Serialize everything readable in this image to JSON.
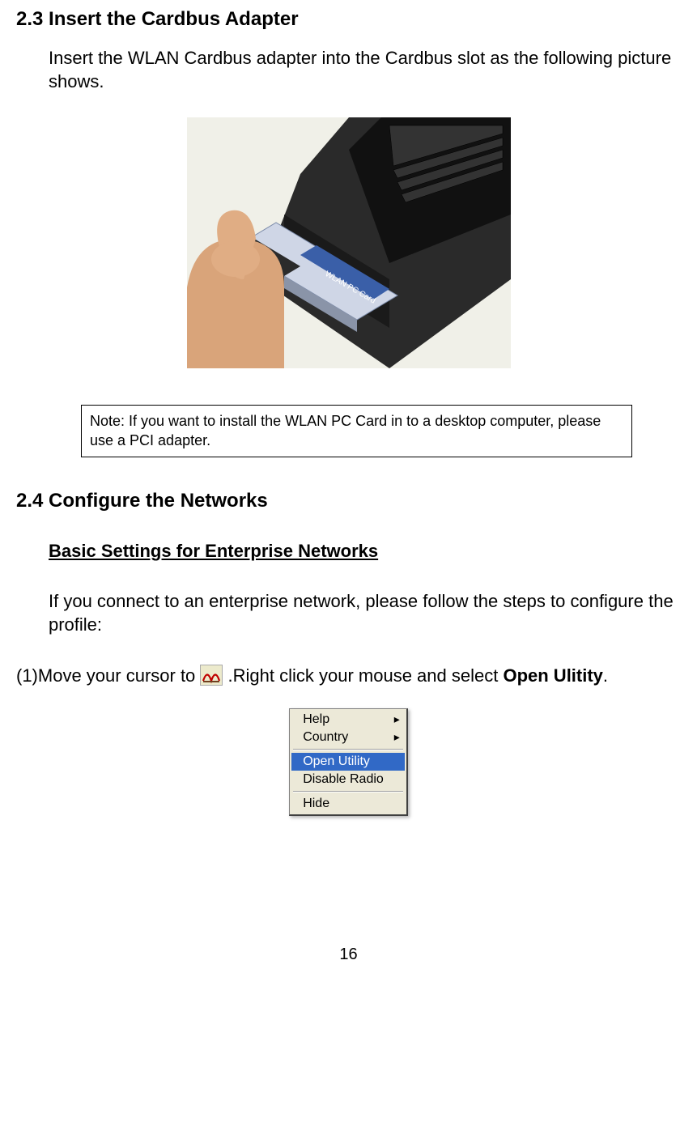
{
  "section23": {
    "heading": "2.3 Insert the Cardbus Adapter",
    "paragraph": "Insert the WLAN Cardbus adapter  into the Cardbus slot as the following picture shows.",
    "note": "Note: If you want to install the WLAN PC Card in to a desktop computer, please use a PCI adapter."
  },
  "section24": {
    "heading": "2.4 Configure the Networks",
    "subheading": "Basic Settings for Enterprise Networks",
    "paragraph": "If you connect to an enterprise network, please follow the steps to configure the profile:",
    "step1_prefix": "(1)Move your cursor to ",
    "step1_mid": ".Right click your mouse and select ",
    "step1_bold": "Open Ulitity",
    "step1_suffix": "."
  },
  "context_menu": {
    "items": [
      {
        "label": "Help",
        "has_sub": true,
        "selected": false
      },
      {
        "label": "Country",
        "has_sub": true,
        "selected": false
      }
    ],
    "items2": [
      {
        "label": "Open Utility",
        "has_sub": false,
        "selected": true
      },
      {
        "label": "Disable Radio",
        "has_sub": false,
        "selected": false
      }
    ],
    "items3": [
      {
        "label": "Hide",
        "has_sub": false,
        "selected": false
      }
    ]
  },
  "tray_icon_name": "wlan-tray-icon",
  "page_number": "16"
}
